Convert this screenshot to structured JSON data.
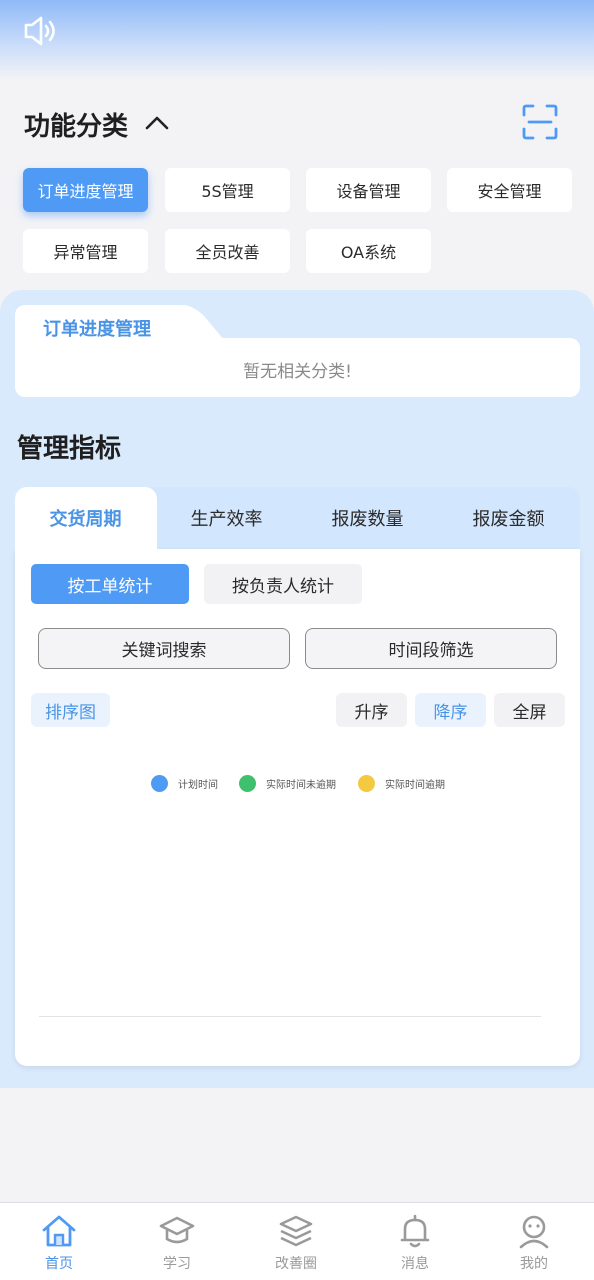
{
  "category": {
    "title": "功能分类",
    "chips": [
      "订单进度管理",
      "5S管理",
      "设备管理",
      "安全管理",
      "异常管理",
      "全员改善",
      "OA系统"
    ],
    "active_index": 0
  },
  "selected": {
    "title": "订单进度管理",
    "empty_text": "暂无相关分类!"
  },
  "management": {
    "title": "管理指标",
    "tabs": [
      "交货周期",
      "生产效率",
      "报废数量",
      "报废金额"
    ],
    "active_tab": 0,
    "stat_modes": [
      "按工单统计",
      "按负责人统计"
    ],
    "filters": {
      "keyword": "关键词搜索",
      "time_range": "时间段筛选"
    },
    "rank_label": "排序图",
    "sort": {
      "asc": "升序",
      "desc": "降序",
      "fullscreen": "全屏"
    },
    "legend": [
      {
        "label": "计划时间",
        "color": "#4f9af5"
      },
      {
        "label": "实际时间未逾期",
        "color": "#3fc06e"
      },
      {
        "label": "实际时间逾期",
        "color": "#f5c842"
      }
    ]
  },
  "nav": {
    "items": [
      "首页",
      "学习",
      "改善圈",
      "消息",
      "我的"
    ],
    "active_index": 0
  },
  "colors": {
    "accent": "#4f9af5",
    "panel": "#d9eafd"
  }
}
